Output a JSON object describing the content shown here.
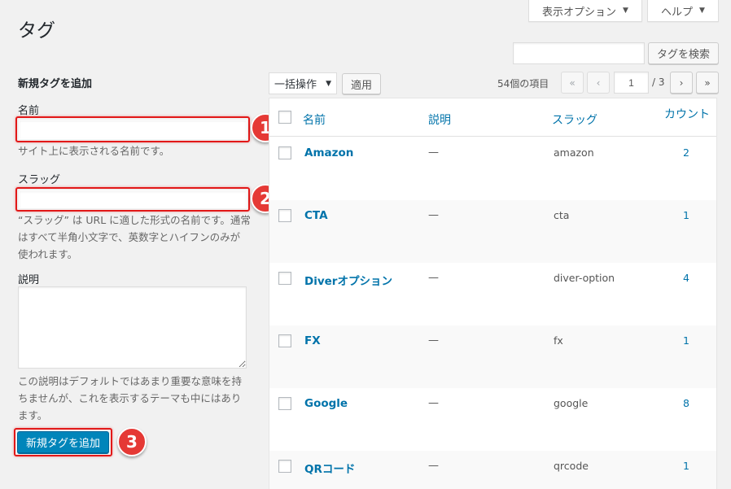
{
  "screen_options": {
    "label": "表示オプション"
  },
  "help": {
    "label": "ヘルプ"
  },
  "page_title": "タグ",
  "search": {
    "value": "",
    "button": "タグを検索"
  },
  "add_form": {
    "heading": "新規タグを追加",
    "name_label": "名前",
    "name_value": "",
    "name_desc": "サイト上に表示される名前です。",
    "slug_label": "スラッグ",
    "slug_value": "",
    "slug_desc_1": "“スラッグ” は URL に適した形式の名前です。通常",
    "slug_desc_2": "はすべて半角小文字で、英数字とハイフンのみが",
    "slug_desc_3": "使われます。",
    "desc_label": "説明",
    "desc_value": "",
    "desc_help_1": "この説明はデフォルトではあまり重要な意味を持",
    "desc_help_2": "ちませんが、これを表示するテーマも中にはあり",
    "desc_help_3": "ます。",
    "submit": "新規タグを追加"
  },
  "annotations": [
    "1",
    "2",
    "3"
  ],
  "bulk": {
    "selected": "一括操作",
    "apply": "適用"
  },
  "pagination": {
    "count_text": "54個の項目",
    "first": "«",
    "prev": "‹",
    "current": "1",
    "total": "/ 3",
    "next": "›",
    "last": "»"
  },
  "table": {
    "headers": {
      "name": "名前",
      "description": "説明",
      "slug": "スラッグ",
      "count": "カウント"
    },
    "rows": [
      {
        "name": "Amazon",
        "description": "—",
        "slug": "amazon",
        "count": "2"
      },
      {
        "name": "CTA",
        "description": "—",
        "slug": "cta",
        "count": "1"
      },
      {
        "name": "Diverオプション",
        "description": "—",
        "slug": "diver-option",
        "count": "4"
      },
      {
        "name": "FX",
        "description": "—",
        "slug": "fx",
        "count": "1"
      },
      {
        "name": "Google",
        "description": "—",
        "slug": "google",
        "count": "8"
      },
      {
        "name": "QRコード",
        "description": "—",
        "slug": "qrcode",
        "count": "1"
      }
    ]
  },
  "colors": {
    "link": "#0073aa",
    "primary": "#0085ba",
    "highlight": "#e21818",
    "badge": "#e53935"
  }
}
